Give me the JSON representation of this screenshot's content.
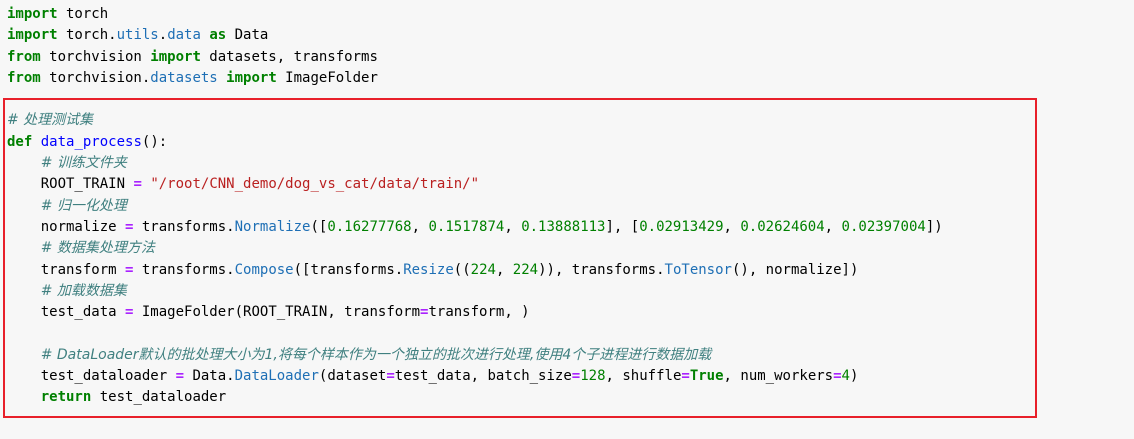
{
  "code_cell": {
    "lines": [
      [
        {
          "t": "kw",
          "v": "import"
        },
        {
          "t": "plain",
          "v": " torch"
        }
      ],
      [
        {
          "t": "kw",
          "v": "import"
        },
        {
          "t": "plain",
          "v": " torch."
        },
        {
          "t": "attr",
          "v": "utils"
        },
        {
          "t": "plain",
          "v": "."
        },
        {
          "t": "attr",
          "v": "data"
        },
        {
          "t": "plain",
          "v": " "
        },
        {
          "t": "kw",
          "v": "as"
        },
        {
          "t": "plain",
          "v": " Data"
        }
      ],
      [
        {
          "t": "kw",
          "v": "from"
        },
        {
          "t": "plain",
          "v": " torchvision "
        },
        {
          "t": "kw",
          "v": "import"
        },
        {
          "t": "plain",
          "v": " datasets, transforms"
        }
      ],
      [
        {
          "t": "kw",
          "v": "from"
        },
        {
          "t": "plain",
          "v": " torchvision."
        },
        {
          "t": "attr",
          "v": "datasets"
        },
        {
          "t": "plain",
          "v": " "
        },
        {
          "t": "kw",
          "v": "import"
        },
        {
          "t": "plain",
          "v": " ImageFolder"
        }
      ],
      [],
      [
        {
          "t": "cm",
          "v": "# 处理测试集"
        }
      ],
      [
        {
          "t": "kw",
          "v": "def"
        },
        {
          "t": "plain",
          "v": " "
        },
        {
          "t": "fn",
          "v": "data_process"
        },
        {
          "t": "plain",
          "v": "():"
        }
      ],
      [
        {
          "t": "plain",
          "v": "    "
        },
        {
          "t": "cm",
          "v": "# 训练文件夹"
        }
      ],
      [
        {
          "t": "plain",
          "v": "    ROOT_TRAIN "
        },
        {
          "t": "op",
          "v": "="
        },
        {
          "t": "plain",
          "v": " "
        },
        {
          "t": "str",
          "v": "\"/root/CNN_demo/dog_vs_cat/data/train/\""
        }
      ],
      [
        {
          "t": "plain",
          "v": "    "
        },
        {
          "t": "cm",
          "v": "# 归一化处理"
        }
      ],
      [
        {
          "t": "plain",
          "v": "    normalize "
        },
        {
          "t": "op",
          "v": "="
        },
        {
          "t": "plain",
          "v": " transforms."
        },
        {
          "t": "attr",
          "v": "Normalize"
        },
        {
          "t": "plain",
          "v": "(["
        },
        {
          "t": "num",
          "v": "0.16277768"
        },
        {
          "t": "plain",
          "v": ", "
        },
        {
          "t": "num",
          "v": "0.1517874"
        },
        {
          "t": "plain",
          "v": ", "
        },
        {
          "t": "num",
          "v": "0.13888113"
        },
        {
          "t": "plain",
          "v": "], ["
        },
        {
          "t": "num",
          "v": "0.02913429"
        },
        {
          "t": "plain",
          "v": ", "
        },
        {
          "t": "num",
          "v": "0.02624604"
        },
        {
          "t": "plain",
          "v": ", "
        },
        {
          "t": "num",
          "v": "0.02397004"
        },
        {
          "t": "plain",
          "v": "])"
        }
      ],
      [
        {
          "t": "plain",
          "v": "    "
        },
        {
          "t": "cm",
          "v": "# 数据集处理方法"
        }
      ],
      [
        {
          "t": "plain",
          "v": "    transform "
        },
        {
          "t": "op",
          "v": "="
        },
        {
          "t": "plain",
          "v": " transforms."
        },
        {
          "t": "attr",
          "v": "Compose"
        },
        {
          "t": "plain",
          "v": "([transforms."
        },
        {
          "t": "attr",
          "v": "Resize"
        },
        {
          "t": "plain",
          "v": "(("
        },
        {
          "t": "num",
          "v": "224"
        },
        {
          "t": "plain",
          "v": ", "
        },
        {
          "t": "num",
          "v": "224"
        },
        {
          "t": "plain",
          "v": ")), transforms."
        },
        {
          "t": "attr",
          "v": "ToTensor"
        },
        {
          "t": "plain",
          "v": "(), normalize])"
        }
      ],
      [
        {
          "t": "plain",
          "v": "    "
        },
        {
          "t": "cm",
          "v": "# 加载数据集"
        }
      ],
      [
        {
          "t": "plain",
          "v": "    test_data "
        },
        {
          "t": "op",
          "v": "="
        },
        {
          "t": "plain",
          "v": " ImageFolder(ROOT_TRAIN, transform"
        },
        {
          "t": "op",
          "v": "="
        },
        {
          "t": "plain",
          "v": "transform, )"
        }
      ],
      [],
      [
        {
          "t": "plain",
          "v": "    "
        },
        {
          "t": "cm",
          "v": "# DataLoader默认的批处理大小为1,将每个样本作为一个独立的批次进行处理,使用4个子进程进行数据加载"
        }
      ],
      [
        {
          "t": "plain",
          "v": "    test_dataloader "
        },
        {
          "t": "op",
          "v": "="
        },
        {
          "t": "plain",
          "v": " Data."
        },
        {
          "t": "attr",
          "v": "DataLoader"
        },
        {
          "t": "plain",
          "v": "(dataset"
        },
        {
          "t": "op",
          "v": "="
        },
        {
          "t": "plain",
          "v": "test_data, batch_size"
        },
        {
          "t": "op",
          "v": "="
        },
        {
          "t": "num",
          "v": "128"
        },
        {
          "t": "plain",
          "v": ", shuffle"
        },
        {
          "t": "op",
          "v": "="
        },
        {
          "t": "kw",
          "v": "True"
        },
        {
          "t": "plain",
          "v": ", num_workers"
        },
        {
          "t": "op",
          "v": "="
        },
        {
          "t": "num",
          "v": "4"
        },
        {
          "t": "plain",
          "v": ")"
        }
      ],
      [
        {
          "t": "plain",
          "v": "    "
        },
        {
          "t": "kw",
          "v": "return"
        },
        {
          "t": "plain",
          "v": " test_dataloader"
        }
      ]
    ]
  },
  "colors": {
    "cell_background": "#f7f7f7",
    "highlight_border": "#e8202a",
    "keyword": "#008000",
    "operator": "#aa22ff",
    "function_name": "#0000ff",
    "attribute": "#1e6fb5",
    "string": "#ba2121",
    "number": "#008000",
    "comment": "#408080"
  }
}
